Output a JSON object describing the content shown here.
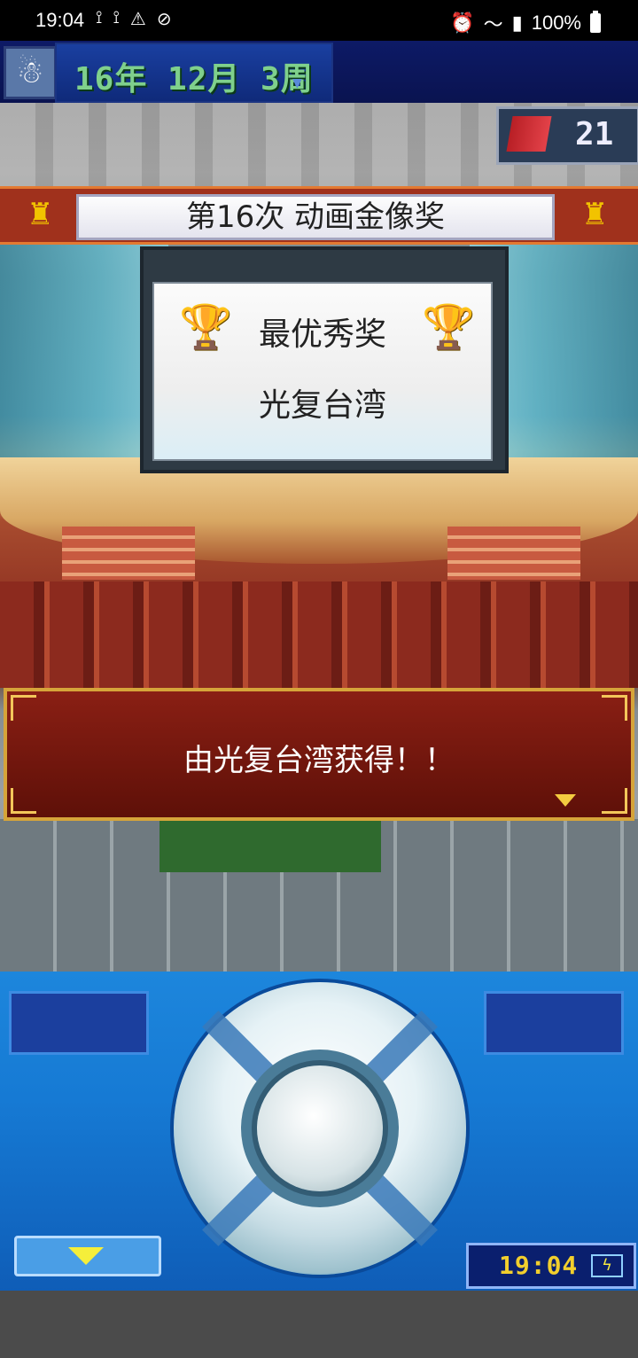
{
  "status_bar": {
    "time": "19:04",
    "battery": "100%",
    "left_icons": [
      "game-icon",
      "game-icon",
      "warning-icon",
      "no-sync-icon"
    ],
    "right_icons": [
      "alarm-icon",
      "wifi-icon",
      "signal-icon",
      "battery-icon"
    ]
  },
  "top_bar": {
    "date": "16年 12月 3周",
    "counter_value": "21"
  },
  "banner": {
    "title": "第16次 动画金像奖"
  },
  "award_board": {
    "award_name": "最优秀奖",
    "winner": "光复台湾"
  },
  "message": {
    "text": "由光复台湾获得！！"
  },
  "controller": {
    "clock": "19:04",
    "battery_icon": "charging-battery-icon"
  }
}
